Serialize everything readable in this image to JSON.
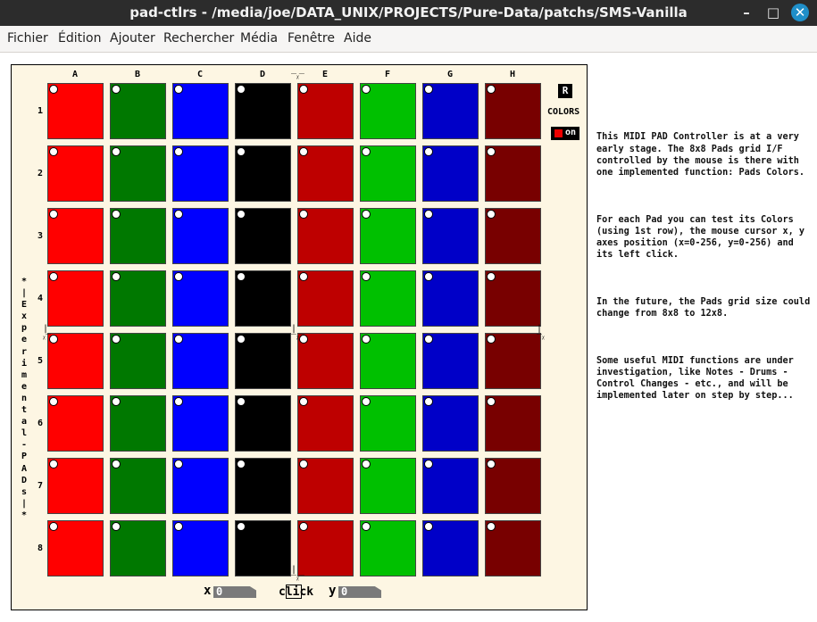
{
  "window": {
    "title": "pad-ctlrs  - /media/joe/DATA_UNIX/PROJECTS/Pure-Data/patchs/SMS-Vanilla",
    "minimize_glyph": "–",
    "maximize_glyph": "□",
    "close_glyph": "✕"
  },
  "menu": [
    "Fichier",
    "Édition",
    "Ajouter",
    "Rechercher",
    "Média",
    "Fenêtre",
    "Aide"
  ],
  "grid": {
    "columns": [
      "A",
      "B",
      "C",
      "D",
      "E",
      "F",
      "G",
      "H"
    ],
    "rows": [
      "1",
      "2",
      "3",
      "4",
      "5",
      "6",
      "7",
      "8"
    ],
    "column_colors": [
      "#ff0000",
      "#007800",
      "#0000ff",
      "#000000",
      "#be0000",
      "#00c000",
      "#0000c8",
      "#780000"
    ]
  },
  "side_label": "*|Experimental-PADs|*",
  "controls": {
    "reset_label": "R",
    "colors_label": "COLORS",
    "toggle_label": "on",
    "x_label": "x",
    "x_value": "0",
    "click_label": "click",
    "y_label": "y",
    "y_value": "0"
  },
  "description": [
    "This MIDI PAD Controller is at a very early stage. The 8x8 Pads grid I/F controlled by the mouse is there with one implemented function: Pads Colors.",
    "For each Pad you can test its Colors (using 1st row), the mouse cursor x, y axes position (x=0-256, y=0-256) and its left click.",
    "In the future, the Pads grid size could change from 8x8 to 12x8.",
    "Some useful MIDI functions are under investigation, like Notes - Drums - Control Changes - etc., and will be implemented later on step by step..."
  ]
}
